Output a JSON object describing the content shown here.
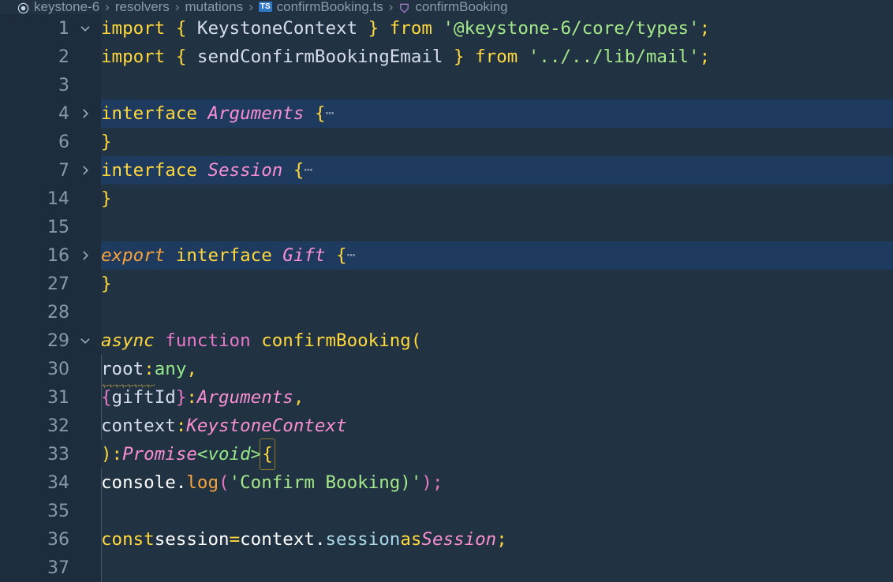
{
  "breadcrumb": {
    "items": [
      {
        "label": "keystone-6",
        "icon": "circle-package-icon"
      },
      {
        "label": "resolvers",
        "icon": null
      },
      {
        "label": "mutations",
        "icon": null
      },
      {
        "label": "confirmBooking.ts",
        "icon": "ts-file-icon",
        "badge": "TS"
      },
      {
        "label": "confirmBooking",
        "icon": "method-symbol-icon"
      }
    ],
    "separator": "›"
  },
  "editor": {
    "language": "typescript",
    "theme_colors": {
      "background": "#213243",
      "gutter": "#1d2d3e",
      "folded_row": "#1e3a5f",
      "line_number": "#8a99a8",
      "keyword": "#ffd83d",
      "string": "#a4e88a",
      "type": "#f78fd2",
      "function": "#e879c8",
      "primitive": "#97e88a",
      "export": "#f7a23b",
      "indent_guide": "#44566b",
      "warning_squiggle": "#e3b341",
      "bracket_match": "#8a7a30"
    },
    "lines": [
      {
        "num": "1",
        "fold": "open",
        "folded": false
      },
      {
        "num": "2",
        "fold": null,
        "folded": false
      },
      {
        "num": "3",
        "fold": null,
        "folded": false
      },
      {
        "num": "4",
        "fold": "closed",
        "folded": true
      },
      {
        "num": "6",
        "fold": null,
        "folded": false
      },
      {
        "num": "7",
        "fold": "closed",
        "folded": true
      },
      {
        "num": "14",
        "fold": null,
        "folded": false
      },
      {
        "num": "15",
        "fold": null,
        "folded": false
      },
      {
        "num": "16",
        "fold": "closed",
        "folded": true
      },
      {
        "num": "27",
        "fold": null,
        "folded": false
      },
      {
        "num": "28",
        "fold": null,
        "folded": false
      },
      {
        "num": "29",
        "fold": "open",
        "folded": false
      },
      {
        "num": "30",
        "fold": null,
        "folded": false
      },
      {
        "num": "31",
        "fold": null,
        "folded": false
      },
      {
        "num": "32",
        "fold": null,
        "folded": false
      },
      {
        "num": "33",
        "fold": null,
        "folded": false
      },
      {
        "num": "34",
        "fold": null,
        "folded": false
      },
      {
        "num": "35",
        "fold": null,
        "folded": false
      },
      {
        "num": "36",
        "fold": null,
        "folded": false
      },
      {
        "num": "37",
        "fold": null,
        "folded": false
      }
    ],
    "code": {
      "l1_import": "import",
      "l1_open": "{",
      "l1_name": "KeystoneContext",
      "l1_close": "}",
      "l1_from": "from",
      "l1_str": "'@keystone-6/core/types'",
      "l1_semi": ";",
      "l2_import": "import",
      "l2_open": "{",
      "l2_name": "sendConfirmBookingEmail",
      "l2_close": "}",
      "l2_from": "from",
      "l2_str": "'../../lib/mail'",
      "l2_semi": ";",
      "l4_interface": "interface",
      "l4_type": "Arguments",
      "l4_brace": "{",
      "l4_ellipsis": "⋯",
      "l6_brace": "}",
      "l7_interface": "interface",
      "l7_type": "Session",
      "l7_brace": "{",
      "l7_ellipsis": "⋯",
      "l14_brace": "}",
      "l16_export": "export",
      "l16_interface": "interface",
      "l16_type": "Gift",
      "l16_brace": "{",
      "l16_ellipsis": "⋯",
      "l27_brace": "}",
      "l29_async": "async",
      "l29_function": "function",
      "l29_name": "confirmBooking",
      "l29_paren": "(",
      "l30_param": "root",
      "l30_colon": ":",
      "l30_type": "any",
      "l30_comma": ",",
      "l31_open": "{",
      "l31_param": "giftId",
      "l31_close": "}",
      "l31_colon": ":",
      "l31_type": "Arguments",
      "l31_comma": ",",
      "l32_param": "context",
      "l32_colon": ":",
      "l32_type": "KeystoneContext",
      "l33_paren": ")",
      "l33_colon": ":",
      "l33_promise": "Promise",
      "l33_lt": "<",
      "l33_void": "void",
      "l33_gt": ">",
      "l33_brace": "{",
      "l34_console": "console",
      "l34_dot": ".",
      "l34_log": "log",
      "l34_lparen": "(",
      "l34_str": "'Confirm Booking)'",
      "l34_rparen": ")",
      "l34_semi": ";",
      "l36_const": "const",
      "l36_name": "session",
      "l36_eq": "=",
      "l36_obj": "context",
      "l36_dot": ".",
      "l36_prop": "session",
      "l36_as": "as",
      "l36_type": "Session",
      "l36_semi": ";"
    }
  }
}
